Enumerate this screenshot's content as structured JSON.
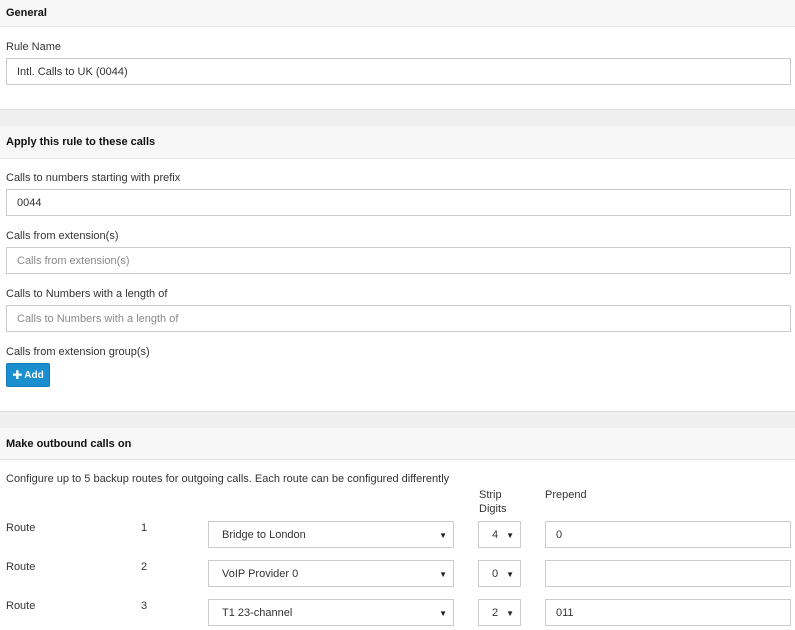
{
  "general": {
    "header": "General",
    "rule_name_label": "Rule Name",
    "rule_name_value": "Intl. Calls to UK (0044)"
  },
  "apply": {
    "header": "Apply this rule to these calls",
    "prefix_label": "Calls to numbers starting with prefix",
    "prefix_value": "0044",
    "from_ext_label": "Calls from extension(s)",
    "from_ext_placeholder": "Calls from extension(s)",
    "length_label": "Calls to Numbers with a length of",
    "length_placeholder": "Calls to Numbers with a length of",
    "group_label": "Calls from extension group(s)",
    "add_label": "Add"
  },
  "outbound": {
    "header": "Make outbound calls on",
    "description": "Configure up to 5 backup routes for outgoing calls. Each route can be configured differently",
    "strip_header_line1": "Strip",
    "strip_header_line2": "Digits",
    "prepend_header": "Prepend",
    "routes": [
      {
        "label": "Route",
        "number": "1",
        "provider": "Bridge to London",
        "strip": "4",
        "prepend": "0"
      },
      {
        "label": "Route",
        "number": "2",
        "provider": "VoIP Provider 0",
        "strip": "0",
        "prepend": ""
      },
      {
        "label": "Route",
        "number": "3",
        "provider": "T1 23-channel",
        "strip": "2",
        "prepend": "011"
      }
    ]
  }
}
